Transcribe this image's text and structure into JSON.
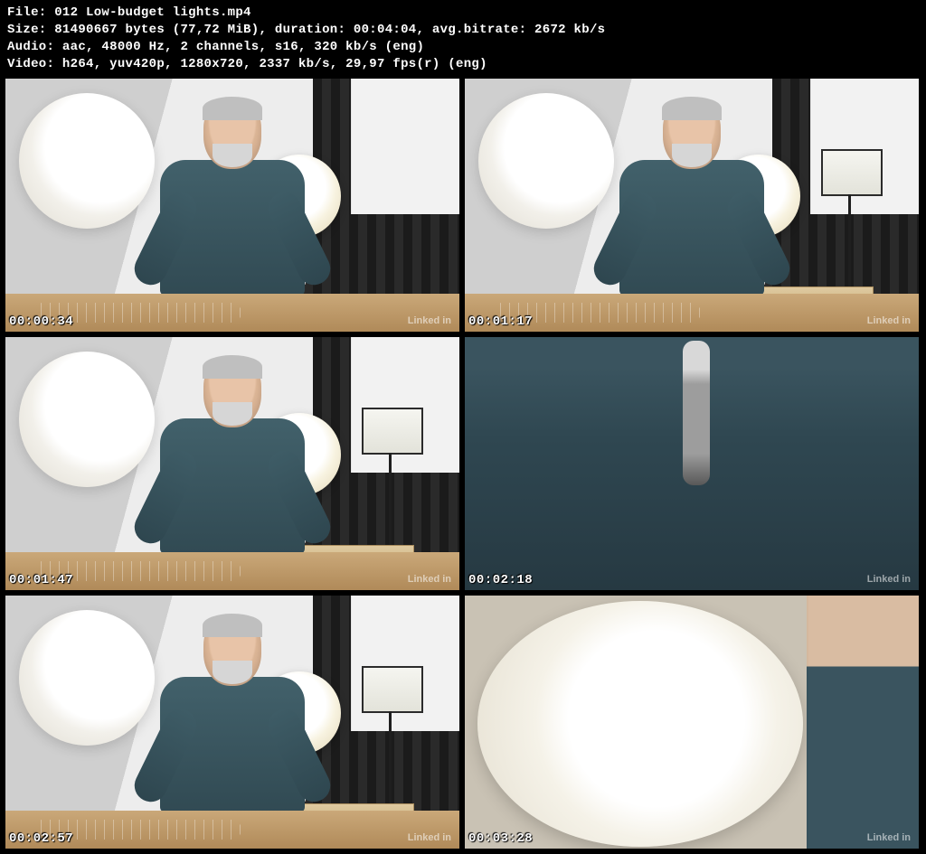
{
  "meta": {
    "file_label": "File:",
    "file_value": "012 Low-budget lights.mp4",
    "size_label": "Size:",
    "size_bytes": "81490667 bytes",
    "size_mib": "(77,72 MiB)",
    "duration_label": "duration:",
    "duration_value": "00:04:04",
    "bitrate_label": "avg.bitrate:",
    "bitrate_value": "2672 kb/s",
    "audio_label": "Audio:",
    "audio_value": "aac, 48000 Hz, 2 channels, s16, 320 kb/s (eng)",
    "video_label": "Video:",
    "video_value": "h264, yuv420p, 1280x720, 2337 kb/s, 29,97 fps(r) (eng)"
  },
  "watermark": "Linked in",
  "frames": [
    {
      "timestamp": "00:00:34"
    },
    {
      "timestamp": "00:01:17"
    },
    {
      "timestamp": "00:01:47"
    },
    {
      "timestamp": "00:02:18"
    },
    {
      "timestamp": "00:02:57"
    },
    {
      "timestamp": "00:03:28"
    }
  ]
}
